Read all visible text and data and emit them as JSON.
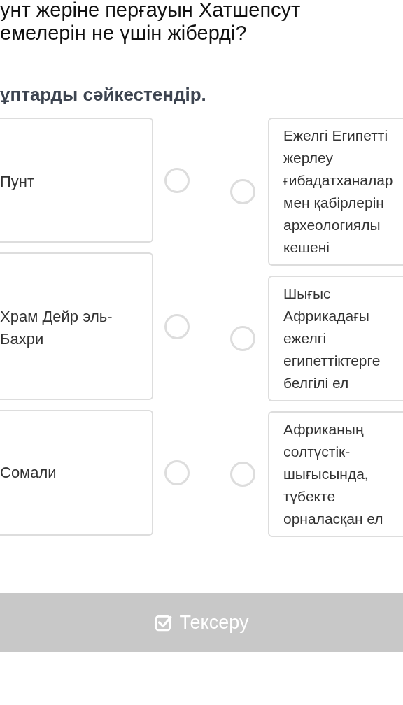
{
  "question": [
    "унт жеріне перғауын Хатшепсут",
    "емелерін не үшін жіберді?"
  ],
  "instruction": "ұптарды сәйкестендір.",
  "left_items": [
    {
      "text": "Пунт"
    },
    {
      "text": "Храм Дейр эль-Бахри"
    },
    {
      "text": "Сомали"
    }
  ],
  "right_items": [
    {
      "lines": [
        "Ежелгі Египетті",
        "жерлеу",
        "ғибадатханалар",
        "мен қабірлерін",
        "археологиялы",
        "кешені"
      ]
    },
    {
      "lines": [
        "Шығыс",
        "Африкадағы",
        "ежелгі",
        "египеттіктерге",
        "белгілі ел"
      ]
    },
    {
      "lines": [
        "Африканың",
        "солтүстік-",
        "шығысында,",
        "түбекте",
        "орналасқан ел"
      ]
    }
  ],
  "check_button": {
    "label": "Тексеру",
    "disabled": true
  }
}
